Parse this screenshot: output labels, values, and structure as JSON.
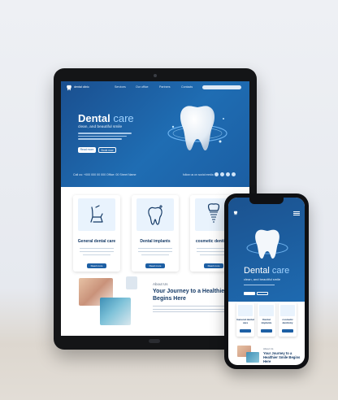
{
  "tablet": {
    "nav": {
      "logo": "dental clinic",
      "links": [
        "Services",
        "Our office",
        "Partners",
        "Contacts"
      ]
    },
    "hero": {
      "title_main": "Dental",
      "title_accent": "care",
      "subtitle": "clean, and beautiful smile",
      "buttons": [
        "Read more",
        "Book now"
      ],
      "contact": "Call us: +000 000 00 000   Office: 00 Street Name",
      "follow": "follow us on social media"
    },
    "cards": [
      {
        "title": "General dental care",
        "icon": "dental-chair-icon",
        "button": "Read more"
      },
      {
        "title": "Dental implants",
        "icon": "sparkling-tooth-icon",
        "button": "Read more"
      },
      {
        "title": "cosmetic dentistry",
        "icon": "tooth-implant-icon",
        "button": "Read more"
      }
    ],
    "about": {
      "label": "About Us",
      "title": "Your Journey to a Healthier Smile Begins Here"
    }
  },
  "phone": {
    "hero": {
      "title_main": "Dental",
      "title_accent": "care",
      "subtitle": "clean, and beautiful smile"
    },
    "cards": [
      {
        "title": "General dental care"
      },
      {
        "title": "Dental implants"
      },
      {
        "title": "cosmetic dentistry"
      }
    ],
    "about": {
      "label": "About Us",
      "title": "Your Journey to a Healthier Smile Begins Here"
    }
  },
  "colors": {
    "primary": "#1d5fa4",
    "hero_dark": "#1a4f8f",
    "accent_text": "#9fd2ff",
    "heading": "#153a66"
  }
}
